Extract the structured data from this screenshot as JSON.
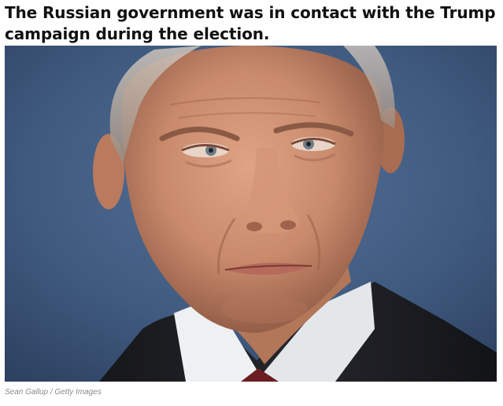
{
  "article": {
    "headline": "The Russian government was in contact with the Trump campaign during the election.",
    "photo_credit": "Sean Gallup / Getty Images"
  },
  "photo": {
    "subject": "close-up portrait of a man in a dark suit, white shirt and dark red tie",
    "colors": {
      "background": "#3e5778",
      "skin": "#c98a6c",
      "suit": "#1d1e22",
      "shirt": "#eef0f2",
      "tie": "#6b1d22"
    }
  }
}
